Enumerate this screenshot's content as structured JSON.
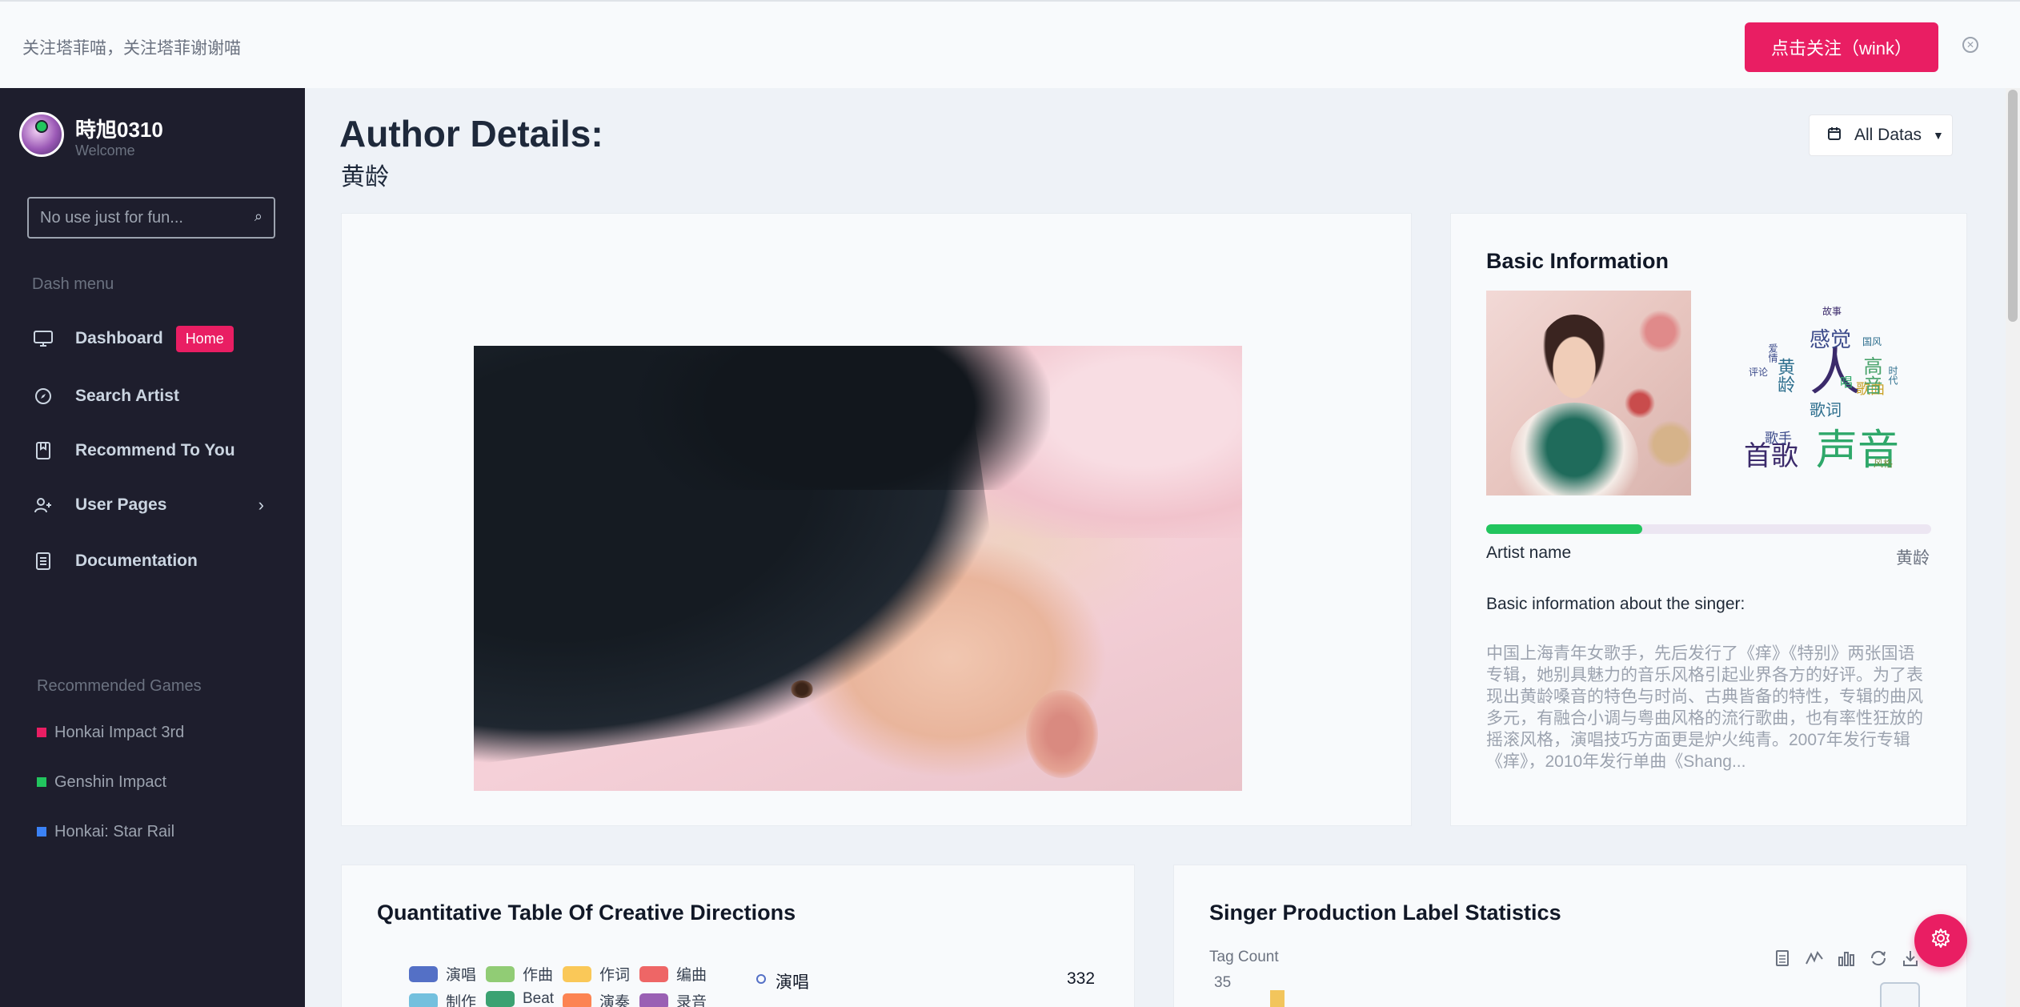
{
  "banner": {
    "text": "关注塔菲喵，关注塔菲谢谢喵",
    "follow_label": "点击关注（wink）",
    "close_icon": "close-circle-icon"
  },
  "sidebar": {
    "user_name": "時旭0310",
    "user_sub": "Welcome",
    "search_placeholder": "No use just for fun...",
    "dash_label": "Dash menu",
    "items": [
      {
        "label": "Dashboard",
        "icon": "monitor-icon",
        "badge": "Home"
      },
      {
        "label": "Search Artist",
        "icon": "compass-icon"
      },
      {
        "label": "Recommend To You",
        "icon": "bookmark-icon"
      },
      {
        "label": "User Pages",
        "icon": "user-plus-icon"
      },
      {
        "label": "Documentation",
        "icon": "document-icon"
      }
    ],
    "games_label": "Recommended Games",
    "games": [
      {
        "label": "Honkai Impact 3rd",
        "color": "#e91e63"
      },
      {
        "label": "Genshin Impact",
        "color": "#22c55e"
      },
      {
        "label": "Honkai: Star Rail",
        "color": "#3b82f6"
      }
    ]
  },
  "main": {
    "title": "Author Details:",
    "subtitle": "黄龄",
    "datas_label": "All Datas"
  },
  "info": {
    "title": "Basic Information",
    "progress": 0.35,
    "artist_label": "Artist name",
    "artist_value": "黄龄",
    "basic_heading": "Basic information about the singer:",
    "basic_text": "中国上海青年女歌手，先后发行了《痒》《特别》两张国语专辑，她别具魅力的音乐风格引起业界各方的好评。为了表现出黄龄嗓音的特色与时尚、古典皆备的特性，专辑的曲风多元，有融合小调与粤曲风格的流行歌曲，也有率性狂放的摇滚风格，演唱技巧方面更是炉火纯青。2007年发行专辑《痒》，2010年发行单曲《Shang...",
    "wordcloud": [
      {
        "text": "人",
        "color": "#3b2a6b"
      },
      {
        "text": "声音",
        "color": "#2fa86a"
      },
      {
        "text": "首歌",
        "color": "#3b2a6b"
      },
      {
        "text": "感觉",
        "color": "#3b4a8a"
      },
      {
        "text": "歌曲",
        "color": "#c9a227"
      },
      {
        "text": "黄龄",
        "color": "#2e6f8e"
      },
      {
        "text": "歌词",
        "color": "#2e6f8e"
      },
      {
        "text": "歌手",
        "color": "#3b4a8a"
      },
      {
        "text": "高音",
        "color": "#49a36b"
      },
      {
        "text": "故事",
        "color": "#3b2a6b"
      },
      {
        "text": "国风",
        "color": "#2e6f8e"
      },
      {
        "text": "评论",
        "color": "#3b4a8a"
      },
      {
        "text": "唱",
        "color": "#2fa86a"
      },
      {
        "text": "风格",
        "color": "#6b8e3a"
      },
      {
        "text": "爱情",
        "color": "#3b4a8a"
      },
      {
        "text": "时代",
        "color": "#2e6f8e"
      }
    ]
  },
  "quant": {
    "title": "Quantitative Table Of Creative Directions",
    "legend": [
      {
        "label": "演唱",
        "color": "#5470c6"
      },
      {
        "label": "作曲",
        "color": "#91cc75"
      },
      {
        "label": "作词",
        "color": "#fac858"
      },
      {
        "label": "编曲",
        "color": "#ee6666"
      },
      {
        "label": "制作",
        "color": "#73c0de"
      },
      {
        "label": "Beat",
        "color": "#3ba272"
      },
      {
        "label": "演奏",
        "color": "#fc8452"
      },
      {
        "label": "录音",
        "color": "#9a60b4"
      }
    ],
    "row_label": "演唱",
    "row_value": "332"
  },
  "label_stats": {
    "title": "Singer Production Label Statistics",
    "tools": [
      "data-view-icon",
      "line-chart-icon",
      "bar-chart-icon",
      "refresh-icon",
      "download-icon"
    ]
  },
  "chart_data": {
    "type": "bar",
    "title": "Singer Production Label Statistics",
    "ylabel": "Tag Count",
    "y_ticks": [
      "35"
    ]
  },
  "fab_icon": "gear-icon"
}
